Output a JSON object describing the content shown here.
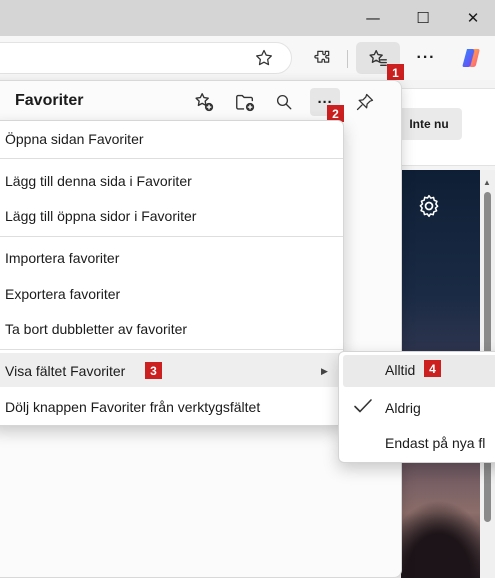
{
  "window": {
    "minimize_glyph": "—",
    "maximize_glyph": "☐",
    "close_glyph": "✕"
  },
  "toolbar": {
    "icons": [
      "star-outline-icon",
      "extensions-icon",
      "favorites-icon",
      "more-icon",
      "copilot-icon"
    ],
    "more_glyph": "···"
  },
  "badges": {
    "b1": "1",
    "b2": "2",
    "b3": "3",
    "b4": "4"
  },
  "favorites_panel": {
    "title": "Favoriter",
    "more_glyph": "···",
    "icons": [
      "add-favorite-icon",
      "add-folder-icon",
      "search-icon",
      "more-options-icon",
      "pin-icon"
    ]
  },
  "page": {
    "not_now_label": "Inte nu"
  },
  "context_menu": {
    "items": [
      "Öppna sidan Favoriter",
      "Lägg till denna sida i Favoriter",
      "Lägg till öppna sidor i Favoriter",
      "Importera favoriter",
      "Exportera favoriter",
      "Ta bort dubbletter av favoriter",
      "Visa fältet Favoriter",
      "Dölj knappen Favoriter från verktygsfältet"
    ],
    "submenu_arrow": "▶"
  },
  "submenu": {
    "items": [
      "Alltid",
      "Aldrig",
      "Endast på nya fl"
    ],
    "checked_item": "Aldrig"
  },
  "colors": {
    "badge_red": "#cc1f1f",
    "highlight": "#eeeeee",
    "panel_bg": "#fbfbfb"
  }
}
